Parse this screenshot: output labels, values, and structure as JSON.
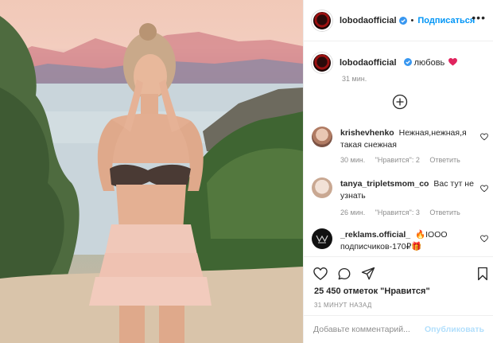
{
  "post": {
    "username": "lobodaofficial",
    "follow_label": "Подписаться",
    "separator": "•",
    "more_label": "•••",
    "caption": "любовь",
    "caption_time": "31 мин."
  },
  "comments": [
    {
      "user": "krishevhenko",
      "text": "Нежная,нежная,я такая снежная",
      "time": "30 мин.",
      "likes": "\"Нравится\": 2",
      "reply": "Ответить"
    },
    {
      "user": "tanya_tripletsmom_co",
      "text": "Вас тут не узнать",
      "time": "26 мин.",
      "likes": "\"Нравится\": 3",
      "reply": "Ответить"
    },
    {
      "user": "_reklams.official_",
      "text": "🔥IOOO подписчиков-170₽🎁"
    }
  ],
  "stats": {
    "likes": "25 450 отметок \"Нравится\"",
    "posted": "31 МИНУТ НАЗАД"
  },
  "composer": {
    "placeholder": "Добавьте комментарий...",
    "publish": "Опубликовать"
  },
  "colors": {
    "link_blue": "#0095f6",
    "heart_red": "#ed4956",
    "muted": "#8e8e8e"
  }
}
